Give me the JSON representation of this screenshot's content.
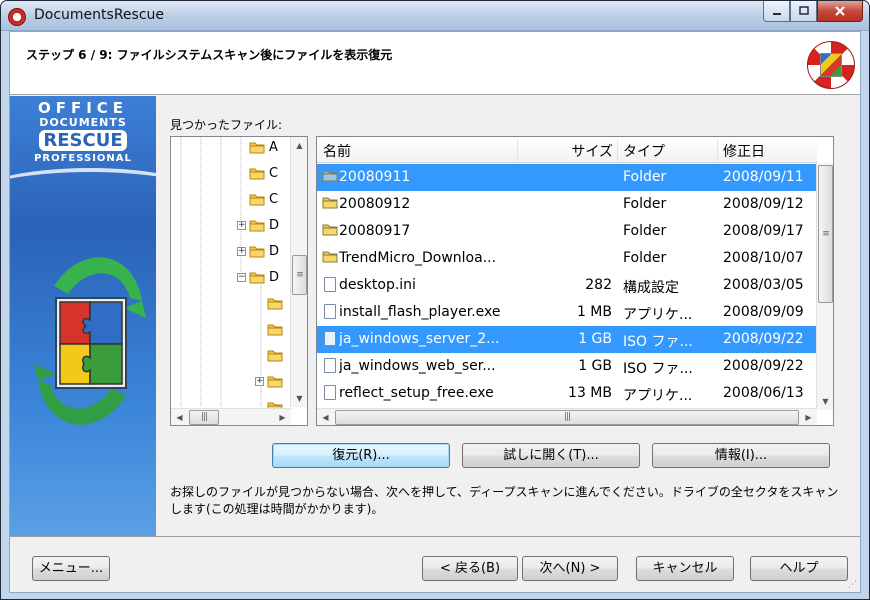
{
  "window": {
    "title": "DocumentsRescue"
  },
  "header": {
    "step_title": "ステップ 6 / 9: ファイルシステムスキャン後にファイルを表示復元"
  },
  "brand": {
    "line1": "OFFICE",
    "line2": "DOCUMENTS",
    "line3": "RESCUE",
    "line4": "PROFESSIONAL"
  },
  "found_label": "見つかったファイル:",
  "tree": {
    "items": [
      {
        "label": "A",
        "expander": ""
      },
      {
        "label": "C",
        "expander": ""
      },
      {
        "label": "C",
        "expander": ""
      },
      {
        "label": "D",
        "expander": "+"
      },
      {
        "label": "D",
        "expander": "+"
      },
      {
        "label": "D",
        "expander": "−"
      },
      {
        "label": "",
        "expander": ""
      },
      {
        "label": "",
        "expander": ""
      },
      {
        "label": "",
        "expander": ""
      },
      {
        "label": "",
        "expander": "+"
      },
      {
        "label": "",
        "expander": ""
      }
    ]
  },
  "list": {
    "columns": {
      "name": "名前",
      "size": "サイズ",
      "type": "タイプ",
      "modified": "修正日"
    },
    "rows": [
      {
        "name": "20080911",
        "size": "",
        "type": "Folder",
        "modified": "2008/09/11",
        "kind": "folder",
        "selected": true
      },
      {
        "name": "20080912",
        "size": "",
        "type": "Folder",
        "modified": "2008/09/12",
        "kind": "folder",
        "selected": false
      },
      {
        "name": "20080917",
        "size": "",
        "type": "Folder",
        "modified": "2008/09/17",
        "kind": "folder",
        "selected": false
      },
      {
        "name": "TrendMicro_Downloa...",
        "size": "",
        "type": "Folder",
        "modified": "2008/10/07",
        "kind": "folder",
        "selected": false
      },
      {
        "name": "desktop.ini",
        "size": "282",
        "type": "構成設定",
        "modified": "2008/03/05",
        "kind": "file",
        "selected": false
      },
      {
        "name": "install_flash_player.exe",
        "size": "1 MB",
        "type": "アプリケ...",
        "modified": "2008/09/09",
        "kind": "file",
        "selected": false
      },
      {
        "name": "ja_windows_server_2...",
        "size": "1 GB",
        "type": "ISO ファ...",
        "modified": "2008/09/22",
        "kind": "file",
        "selected": true
      },
      {
        "name": "ja_windows_web_ser...",
        "size": "1 GB",
        "type": "ISO ファ...",
        "modified": "2008/09/22",
        "kind": "file",
        "selected": false
      },
      {
        "name": "reflect_setup_free.exe",
        "size": "13 MB",
        "type": "アプリケ...",
        "modified": "2008/06/13",
        "kind": "file",
        "selected": false
      }
    ]
  },
  "actions": {
    "restore": "復元(R)...",
    "try_open": "試しに開く(T)...",
    "info": "情報(I)..."
  },
  "info_text": "お探しのファイルが見つからない場合、次へを押して、ディープスキャンに進んでください。ドライブの全セクタをスキャンします(この処理は時間がかかります)。",
  "footer": {
    "menu": "メニュー...",
    "back": "< 戻る(B)",
    "next": "次へ(N) >",
    "cancel": "キャンセル",
    "help": "ヘルプ"
  },
  "colors": {
    "selection": "#3399ff",
    "sidebar": "#2a63b8",
    "folder": "#f2c94c"
  }
}
